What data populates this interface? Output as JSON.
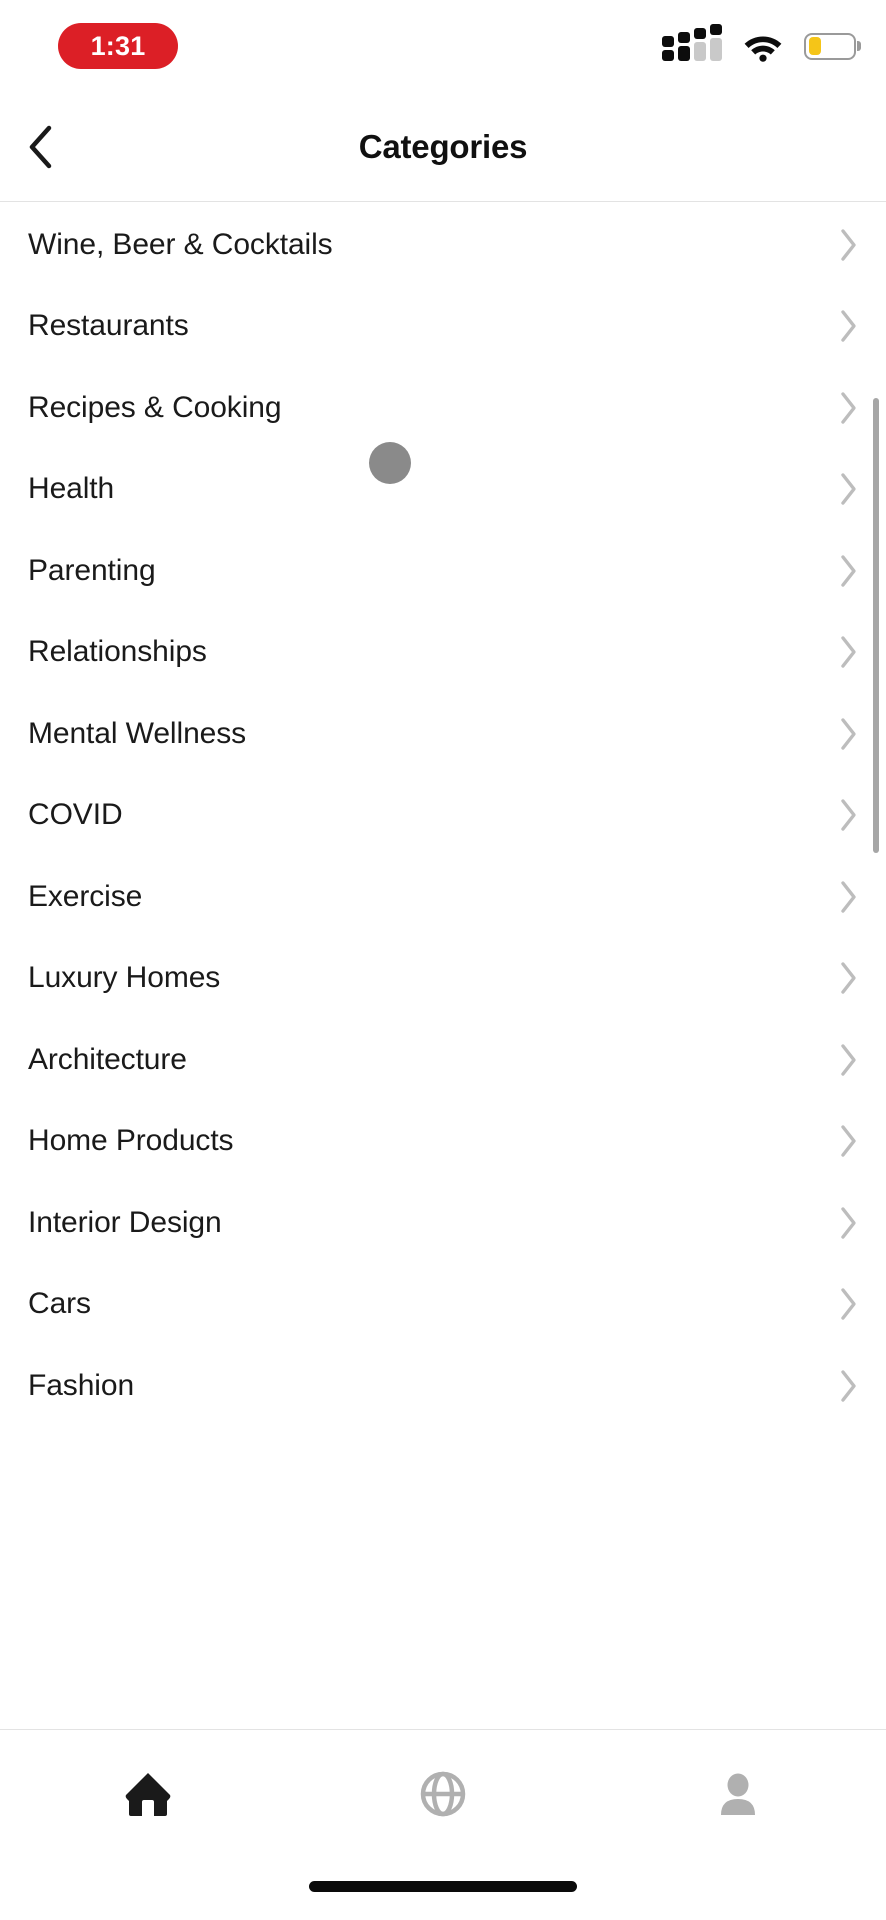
{
  "status_bar": {
    "recording_time": "1:31",
    "recording_pill_color": "#DC1F26",
    "signal_icon": "cellular-signal-icon",
    "signal_bars_total": 4,
    "signal_bars_active": 2,
    "wifi_icon": "wifi-icon",
    "wifi_strength": "full",
    "battery_icon": "battery-icon",
    "battery_level_percent": 28,
    "battery_fill_color": "#F5C518",
    "battery_outline_color": "#9a9a9a"
  },
  "nav": {
    "back_icon": "chevron-left-icon",
    "title": "Categories"
  },
  "list": {
    "chevron_icon": "chevron-right-icon",
    "chevron_color": "#bdbdbd",
    "items": [
      {
        "label": "Wine, Beer & Cocktails"
      },
      {
        "label": "Restaurants"
      },
      {
        "label": "Recipes & Cooking"
      },
      {
        "label": "Health"
      },
      {
        "label": "Parenting"
      },
      {
        "label": "Relationships"
      },
      {
        "label": "Mental Wellness"
      },
      {
        "label": "COVID"
      },
      {
        "label": "Exercise"
      },
      {
        "label": "Luxury Homes"
      },
      {
        "label": "Architecture"
      },
      {
        "label": "Home Products"
      },
      {
        "label": "Interior Design"
      },
      {
        "label": "Cars"
      },
      {
        "label": "Fashion"
      }
    ]
  },
  "overlay": {
    "touch_indicator_color": "#8a8a8a",
    "scrollbar_color": "#a6a6a6"
  },
  "tabbar": {
    "active_color": "#1a1a1a",
    "inactive_color": "#b0b0b0",
    "tabs": [
      {
        "icon": "home-icon",
        "active": true
      },
      {
        "icon": "globe-icon",
        "active": false
      },
      {
        "icon": "person-icon",
        "active": false
      }
    ]
  }
}
